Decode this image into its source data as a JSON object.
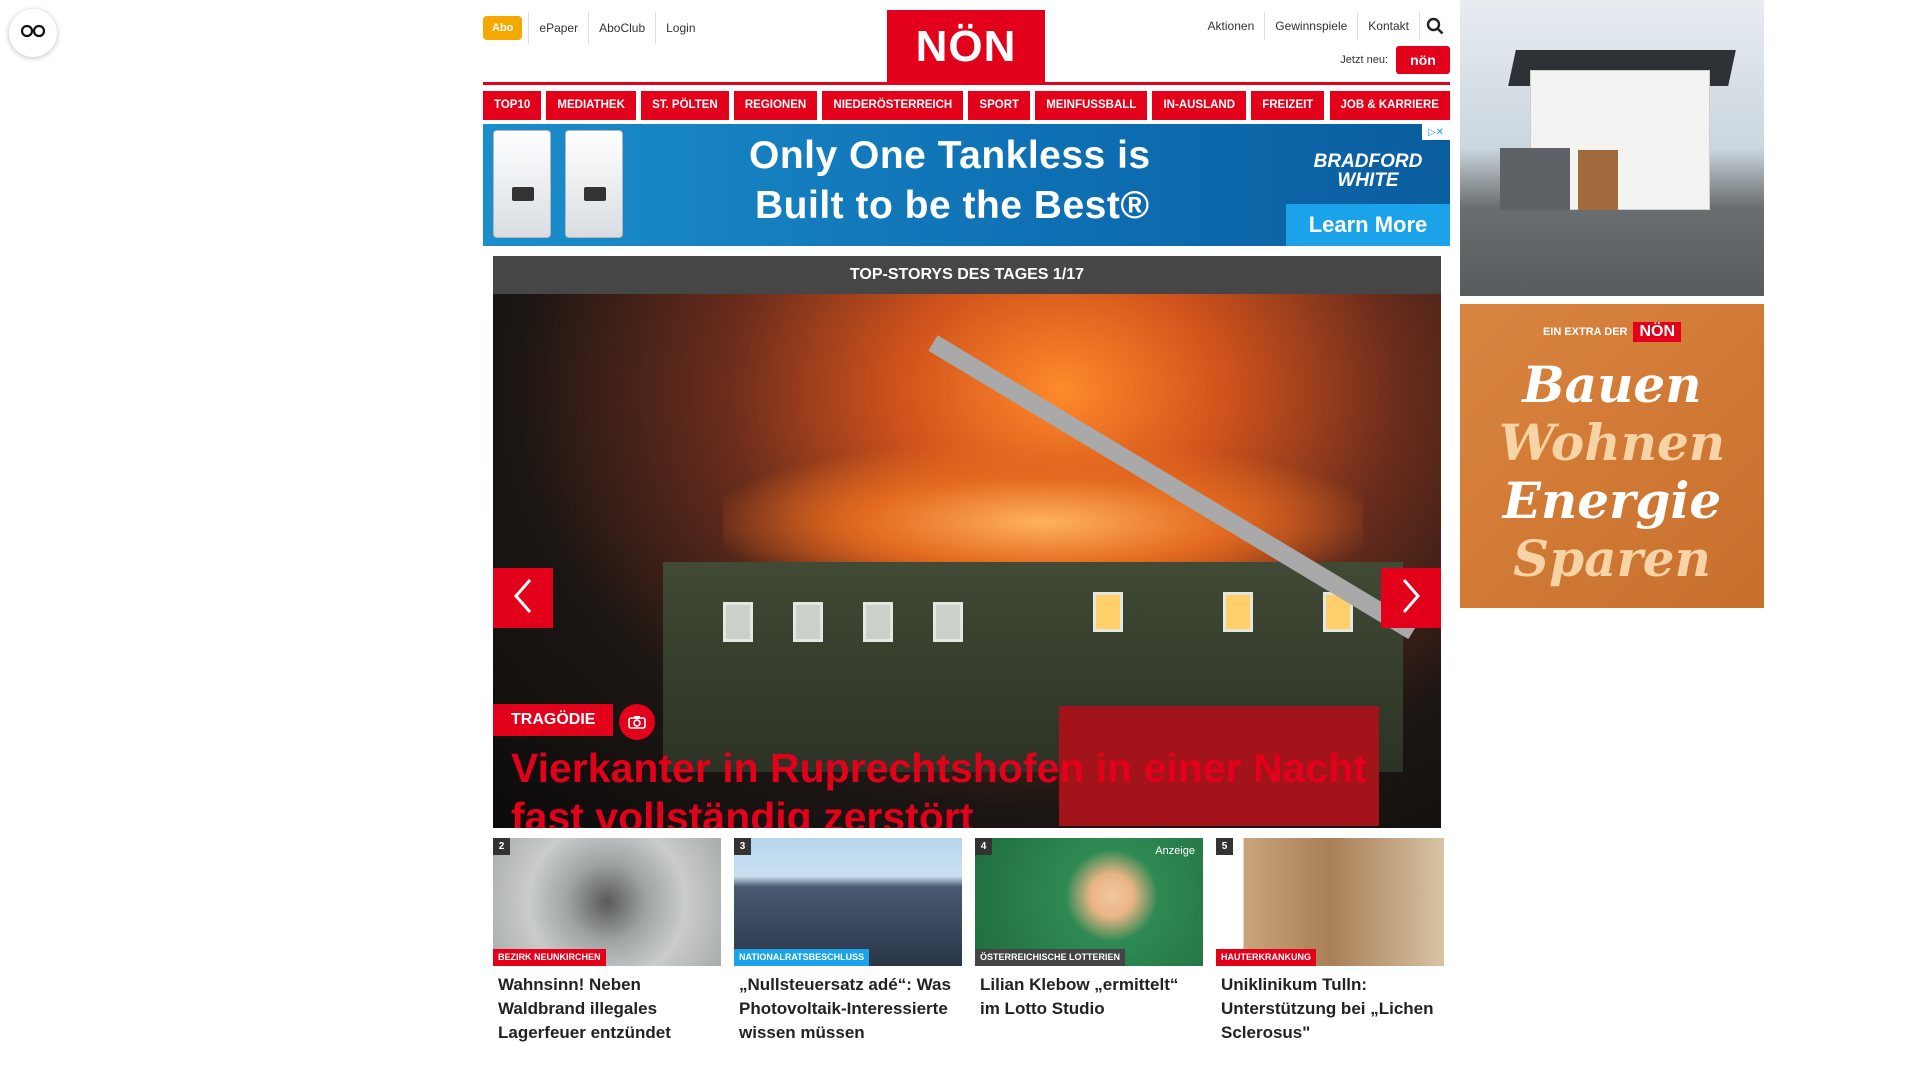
{
  "header": {
    "abo_label": "Abo",
    "left_links": [
      "ePaper",
      "AboClub",
      "Login"
    ],
    "logo_text": "NÖN",
    "right_links": [
      "Aktionen",
      "Gewinnspiele",
      "Kontakt"
    ],
    "jetzt_label": "Jetzt neu:",
    "jetzt_badge": "nön"
  },
  "nav": {
    "items": [
      "TOP10",
      "MEDIATHEK",
      "ST. PÖLTEN",
      "REGIONEN",
      "NIEDERÖSTERREICH",
      "SPORT",
      "MEINFUSSBALL",
      "IN-AUSLAND",
      "FREIZEIT",
      "JOB & KARRIERE"
    ]
  },
  "ad": {
    "line1": "Only One Tankless is",
    "line2": "Built to be the Best®",
    "brand": "BRADFORD WHITE",
    "cta": "Learn More"
  },
  "slider": {
    "heading": "TOP-STORYS DES TAGES 1/17",
    "kicker": "TRAGÖDIE",
    "headline": "Vierkanter in Ruprechtshofen in einer Nacht fast vollständig zerstört"
  },
  "teasers": [
    {
      "num": "2",
      "tag": "BEZIRK NEUNKIRCHEN",
      "tag_color": "#e2001a",
      "title": "Wahnsinn! Neben Waldbrand illegales Lagerfeuer entzündet",
      "anzeige": ""
    },
    {
      "num": "3",
      "tag": "NATIONALRATSBESCHLUSS",
      "tag_color": "#1aa3e8",
      "title": "„Nullsteuersatz adé“: Was Photovoltaik-Interessierte wissen müssen",
      "anzeige": ""
    },
    {
      "num": "4",
      "tag": "ÖSTERREICHISCHE LOTTERIEN",
      "tag_color": "#444444",
      "title": "Lilian Klebow „ermittelt“ im Lotto Studio",
      "anzeige": "Anzeige"
    },
    {
      "num": "5",
      "tag": "HAUTERKRANKUNG",
      "tag_color": "#e2001a",
      "title": "Uniklinikum Tulln: Unterstützung bei „Lichen Sclerosus\"",
      "anzeige": ""
    }
  ],
  "sidebar": {
    "extra_label": "EIN EXTRA DER",
    "extra_logo": "NÖN",
    "words": [
      "Bauen",
      "Wohnen",
      "Energie",
      "Sparen"
    ]
  },
  "colors": {
    "brand_red": "#e2001a",
    "abo_orange": "#f5a800"
  }
}
